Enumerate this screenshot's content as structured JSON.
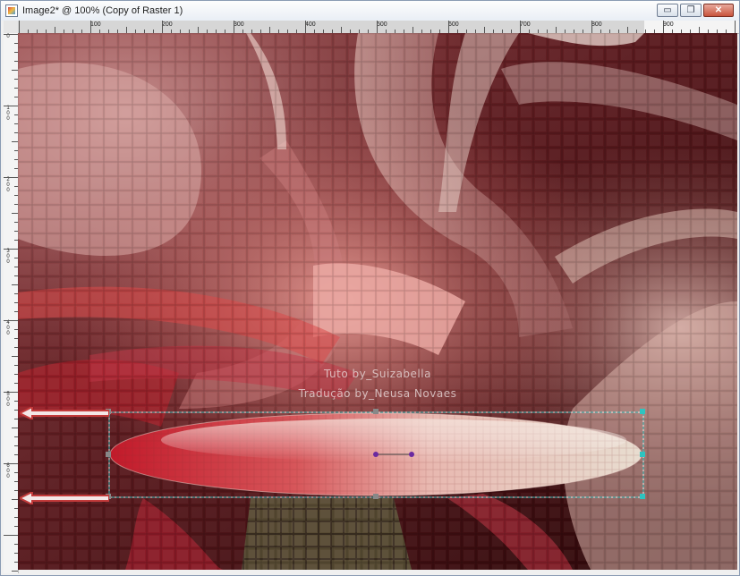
{
  "window": {
    "title": "Image2* @ 100% (Copy of Raster 1)",
    "controls": {
      "minimize": "▭",
      "restore": "❐",
      "close": "✕"
    }
  },
  "ruler": {
    "top_labels": [
      "100",
      "200",
      "300",
      "400",
      "500",
      "600",
      "700",
      "800",
      "900"
    ],
    "left_labels": [
      "0",
      "100",
      "200",
      "300",
      "400",
      "500",
      "600"
    ]
  },
  "canvas": {
    "watermark_line1": "Tuto by_Suizabella",
    "watermark_line2": "Tradução by_Neusa Novaes"
  },
  "colors": {
    "background_dark": "#3a0a0e",
    "accent_red": "#c8202c",
    "selection_handle": "#2ec4c0",
    "arrow_red": "#c23a3a"
  }
}
